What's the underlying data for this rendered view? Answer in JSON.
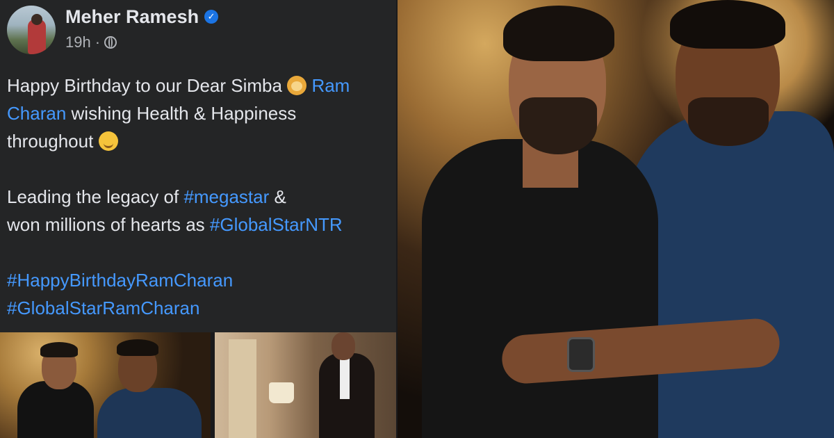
{
  "post": {
    "author": "Meher Ramesh",
    "time": "19h",
    "separator": "·",
    "line1_prefix": "Happy Birthday to our Dear Simba",
    "mention_1": "Ram",
    "mention_2": "Charan",
    "line2_suffix": "wishing Health & Happiness",
    "line3": "throughout",
    "para2_line1_prefix": "Leading the legacy of",
    "hashtag_megastar": "#megastar",
    "para2_line1_suffix": "&",
    "para2_line2_prefix": "won millions of hearts as",
    "hashtag_globalstarntr": "#GlobalStarNTR",
    "hashtag_birthday": "#HappyBirthdayRamCharan",
    "hashtag_globalstar": "#GlobalStarRamCharan"
  },
  "icons": {
    "verified": "verified-badge-icon",
    "audience": "globe-icon",
    "lion": "lion-face-emoji",
    "smile": "smiling-face-with-halo-emoji"
  },
  "colors": {
    "panel_bg": "#242526",
    "text": "#e4e6eb",
    "link": "#4599ff",
    "verified": "#1b74e4"
  }
}
